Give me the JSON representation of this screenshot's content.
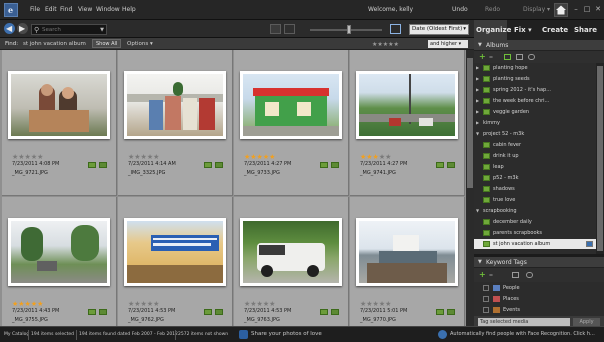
{
  "menubar": {
    "logo_letter": "e",
    "items": [
      "File",
      "Edit",
      "Find",
      "View",
      "Window",
      "Help"
    ],
    "welcome": "Welcome, kelly",
    "undo": "Undo",
    "redo": "Redo",
    "display": "Display ▾",
    "window_controls": [
      "–",
      "□",
      "✕"
    ]
  },
  "toolbar": {
    "search_placeholder": "Search",
    "sort": "Date (Oldest First)"
  },
  "findbar": {
    "label": "Find:",
    "value": "st john vacation album",
    "show_all": "Show All",
    "options": "Options ▾",
    "filter_stars": "★★★★★",
    "rating_filter": "and higher ▾"
  },
  "photos": [
    {
      "date": "7/23/2011 4:08 PM",
      "file": "_MG_9721.JPG",
      "rating": 0
    },
    {
      "date": "7/23/2011 4:14 AM",
      "file": "_IMG_3325.JPG",
      "rating": 0
    },
    {
      "date": "7/23/2011 4:27 PM",
      "file": "_MG_9733.JPG",
      "rating": 5
    },
    {
      "date": "7/23/2011 4:27 PM",
      "file": "_MG_9741.JPG",
      "rating": 3
    },
    {
      "date": "7/23/2011 4:43 PM",
      "file": "_MG_9755.JPG",
      "rating": 5
    },
    {
      "date": "7/23/2011 4:53 PM",
      "file": "_MG_9762.JPG",
      "rating": 0
    },
    {
      "date": "7/23/2011 4:53 PM",
      "file": "_MG_9763.JPG",
      "rating": 0
    },
    {
      "date": "7/23/2011 5:01 PM",
      "file": "_MG_9770.JPG",
      "rating": 0
    }
  ],
  "panel": {
    "tabs": [
      "Organize",
      "Fix ▾",
      "Create",
      "Share"
    ],
    "albums_title": "Albums",
    "albums": [
      {
        "label": "planting hope",
        "type": "album",
        "indent": 1
      },
      {
        "label": "planting seeds",
        "type": "album",
        "indent": 1
      },
      {
        "label": "spring 2012 - it's hap...",
        "type": "album",
        "indent": 1
      },
      {
        "label": "the week before chri...",
        "type": "album",
        "indent": 1
      },
      {
        "label": "veggie garden",
        "type": "album",
        "indent": 1
      },
      {
        "label": "kimmy",
        "type": "group",
        "indent": 0
      },
      {
        "label": "project 52 - m3k",
        "type": "group",
        "indent": 0
      },
      {
        "label": "cabin fever",
        "type": "album",
        "indent": 1
      },
      {
        "label": "drink it up",
        "type": "album",
        "indent": 1
      },
      {
        "label": "leap",
        "type": "album",
        "indent": 1
      },
      {
        "label": "p52 - m3k",
        "type": "album",
        "indent": 1
      },
      {
        "label": "shadows",
        "type": "album",
        "indent": 1
      },
      {
        "label": "true love",
        "type": "album",
        "indent": 1
      },
      {
        "label": "scrapbooking",
        "type": "group",
        "indent": 0
      },
      {
        "label": "december daily",
        "type": "album",
        "indent": 1
      },
      {
        "label": "parents scrapbooks",
        "type": "album",
        "indent": 1
      },
      {
        "label": "st john vacation album",
        "type": "album",
        "indent": 1,
        "selected": true
      }
    ],
    "keywords_title": "Keyword Tags",
    "keywords": [
      {
        "label": "People",
        "color": "#5a7fc0"
      },
      {
        "label": "Places",
        "color": "#c05050"
      },
      {
        "label": "Events",
        "color": "#b07030"
      }
    ],
    "tag_selected": "Tag selected media",
    "apply": "Apply"
  },
  "status": {
    "catalog": "My Catalog",
    "items_selected": "194 items selected",
    "items_found": "194 items found dated Feb 2007 - Feb 2012",
    "items_not_shown": "2572 items not shown",
    "share": "Share your photos of love",
    "face": "Automatically find people with Face Recognition. Click h..."
  }
}
